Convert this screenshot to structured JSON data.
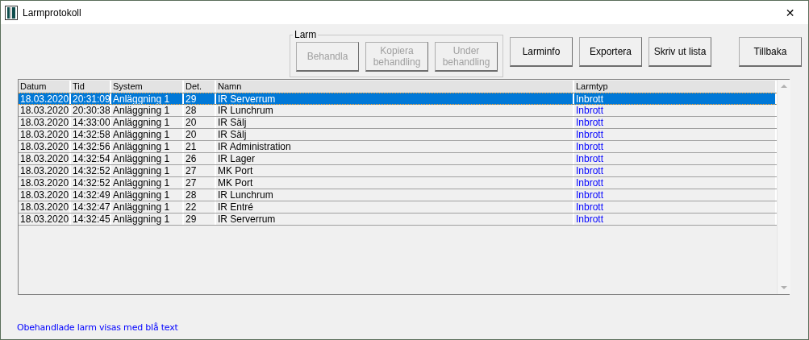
{
  "window": {
    "title": "Larmprotokoll",
    "close": "✕"
  },
  "group": {
    "label": "Larm",
    "buttons": [
      {
        "label": "Behandla",
        "disabled": true
      },
      {
        "label": "Kopiera behandling",
        "disabled": true
      },
      {
        "label": "Under behandling",
        "disabled": true
      }
    ]
  },
  "buttons": [
    {
      "label": "Larminfo",
      "disabled": false
    },
    {
      "label": "Exportera",
      "disabled": false
    },
    {
      "label": "Skriv ut lista",
      "disabled": false
    },
    {
      "label": "Tillbaka",
      "disabled": false
    }
  ],
  "table": {
    "columns": [
      "Datum",
      "Tid",
      "System",
      "Det.",
      "Namn",
      "Larmtyp"
    ],
    "rows": [
      {
        "cells": [
          "18.03.2020",
          "20:31:09",
          "Anläggning 1",
          "29",
          "IR Serverrum",
          "Inbrott"
        ],
        "selected": true
      },
      {
        "cells": [
          "18.03.2020",
          "20:30:38",
          "Anläggning 1",
          "28",
          "IR Lunchrum",
          "Inbrott"
        ],
        "selected": false,
        "unhandled": true
      },
      {
        "cells": [
          "18.03.2020",
          "14:33:00",
          "Anläggning 1",
          "20",
          "IR Sälj",
          "Inbrott"
        ],
        "selected": false,
        "unhandled": true
      },
      {
        "cells": [
          "18.03.2020",
          "14:32:58",
          "Anläggning 1",
          "20",
          "IR Sälj",
          "Inbrott"
        ],
        "selected": false,
        "unhandled": true
      },
      {
        "cells": [
          "18.03.2020",
          "14:32:56",
          "Anläggning 1",
          "21",
          "IR Administration",
          "Inbrott"
        ],
        "selected": false,
        "unhandled": true
      },
      {
        "cells": [
          "18.03.2020",
          "14:32:54",
          "Anläggning 1",
          "26",
          "IR Lager",
          "Inbrott"
        ],
        "selected": false,
        "unhandled": true
      },
      {
        "cells": [
          "18.03.2020",
          "14:32:52",
          "Anläggning 1",
          "27",
          "MK Port",
          "Inbrott"
        ],
        "selected": false,
        "unhandled": true
      },
      {
        "cells": [
          "18.03.2020",
          "14:32:52",
          "Anläggning 1",
          "27",
          "MK Port",
          "Inbrott"
        ],
        "selected": false,
        "unhandled": true
      },
      {
        "cells": [
          "18.03.2020",
          "14:32:49",
          "Anläggning 1",
          "28",
          "IR Lunchrum",
          "Inbrott"
        ],
        "selected": false,
        "unhandled": true
      },
      {
        "cells": [
          "18.03.2020",
          "14:32:47",
          "Anläggning 1",
          "22",
          "IR Entré",
          "Inbrott"
        ],
        "selected": false,
        "unhandled": true
      },
      {
        "cells": [
          "18.03.2020",
          "14:32:45",
          "Anläggning 1",
          "29",
          "IR Serverrum",
          "Inbrott"
        ],
        "selected": false,
        "unhandled": true
      }
    ]
  },
  "status_text": "Obehandlade larm visas med blå text"
}
